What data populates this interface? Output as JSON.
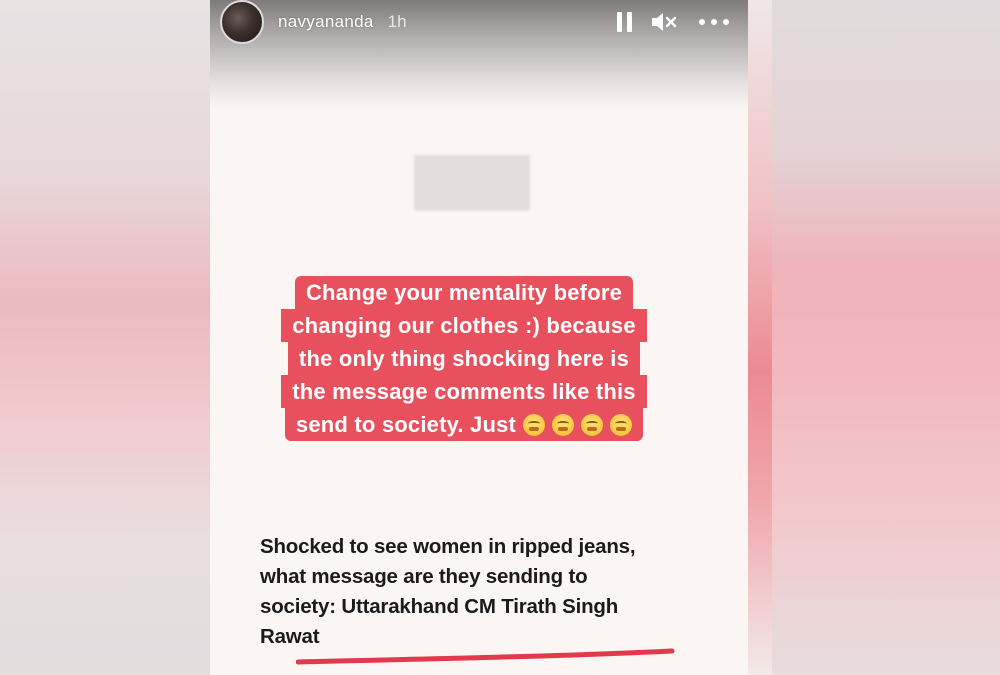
{
  "story": {
    "username": "navyananda",
    "time": "1h",
    "sticker_lines": [
      "Change your mentality before",
      "changing our clothes :) because",
      "the only thing shocking here is",
      "the message comments like this",
      "send to society. Just"
    ],
    "sticker_emoji_count": 4,
    "sticker_emoji_name": "steam-from-nose-emoji",
    "headline_lines": [
      "Shocked to see women in ripped jeans,",
      "what message are they sending to",
      "society: Uttarakhand CM Tirath Singh",
      "Rawat"
    ]
  },
  "colors": {
    "sticker_bg": "#e8505e",
    "underline": "#e23a4c",
    "panel_bg": "#fbf5f4"
  },
  "icons": {
    "pause": "pause-icon",
    "mute": "mute-icon",
    "more": "more-options-icon"
  }
}
